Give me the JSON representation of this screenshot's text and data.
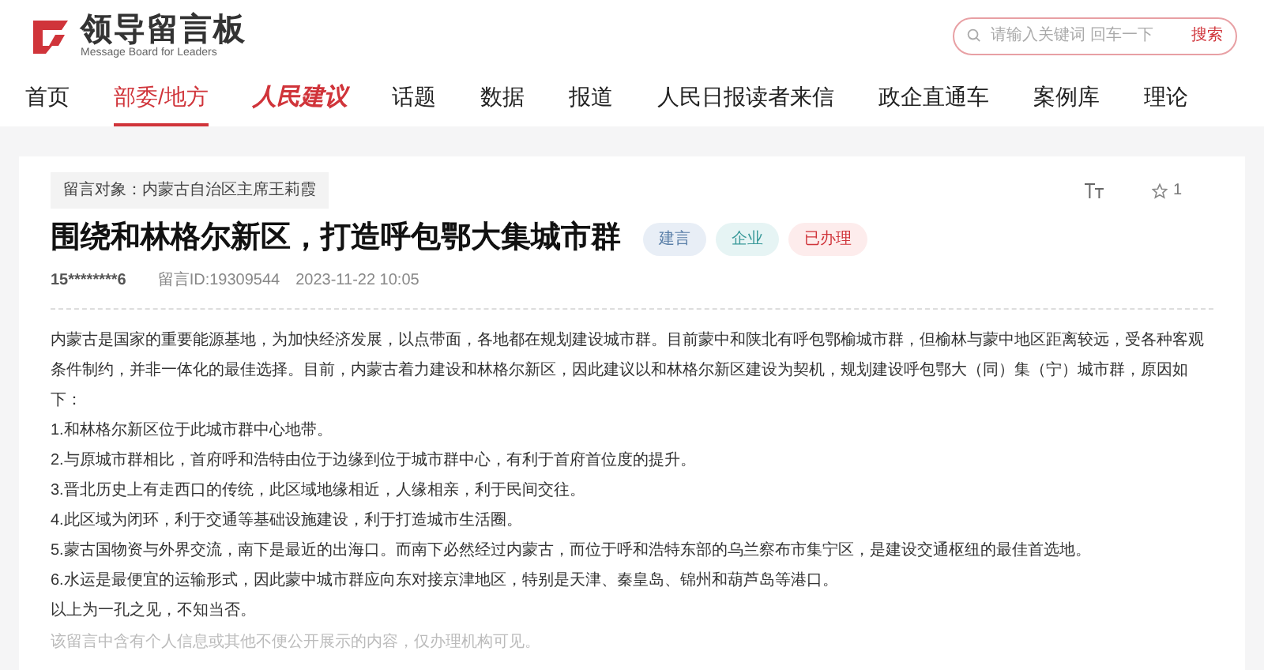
{
  "header": {
    "logo_title": "领导留言板",
    "logo_subtitle": "Message Board for Leaders",
    "search": {
      "placeholder": "请输入关键词 回车一下",
      "button": "搜索"
    }
  },
  "nav": [
    {
      "label": "首页",
      "selected": false,
      "kind": "text"
    },
    {
      "label": "部委/地方",
      "selected": true,
      "kind": "text"
    },
    {
      "label": "人民建议",
      "selected": false,
      "kind": "logo"
    },
    {
      "label": "话题",
      "selected": false,
      "kind": "text"
    },
    {
      "label": "数据",
      "selected": false,
      "kind": "text"
    },
    {
      "label": "报道",
      "selected": false,
      "kind": "text"
    },
    {
      "label": "人民日报读者来信",
      "selected": false,
      "kind": "text"
    },
    {
      "label": "政企直通车",
      "selected": false,
      "kind": "text"
    },
    {
      "label": "案例库",
      "selected": false,
      "kind": "text"
    },
    {
      "label": "理论",
      "selected": false,
      "kind": "text"
    }
  ],
  "message": {
    "recipient": "留言对象：内蒙古自治区主席王莉霞",
    "title": "围绕和林格尔新区，打造呼包鄂大集城市群",
    "tags": [
      {
        "label": "建言",
        "color": "#e8eef6"
      },
      {
        "label": "企业",
        "color": "#e6f4f4"
      },
      {
        "label": "已办理",
        "color": "#fdecec"
      }
    ],
    "favorites": "1",
    "author": "15********6",
    "message_id": "留言ID:19309544",
    "time": "2023-11-22 10:05",
    "paragraphs": [
      "内蒙古是国家的重要能源基地，为加快经济发展，以点带面，各地都在规划建设城市群。目前蒙中和陕北有呼包鄂榆城市群，但榆林与蒙中地区距离较远，受各种客观条件制约，并非一体化的最佳选择。目前，内蒙古着力建设和林格尔新区，因此建议以和林格尔新区建设为契机，规划建设呼包鄂大（同）集（宁）城市群，原因如下：",
      "1.和林格尔新区位于此城市群中心地带。",
      "2.与原城市群相比，首府呼和浩特由位于边缘到位于城市群中心，有利于首府首位度的提升。",
      "3.晋北历史上有走西口的传统，此区域地缘相近，人缘相亲，利于民间交往。",
      "4.此区域为闭环，利于交通等基础设施建设，利于打造城市生活圈。",
      "5.蒙古国物资与外界交流，南下是最近的出海口。而南下必然经过内蒙古，而位于呼和浩特东部的乌兰察布市集宁区，是建设交通枢纽的最佳首选地。",
      "6.水运是最便宜的运输形式，因此蒙中城市群应向东对接京津地区，特别是天津、秦皇岛、锦州和葫芦岛等港口。",
      "以上为一孔之见，不知当否。"
    ],
    "notice": "该留言中含有个人信息或其他不便公开展示的内容，仅办理机构可见。"
  }
}
